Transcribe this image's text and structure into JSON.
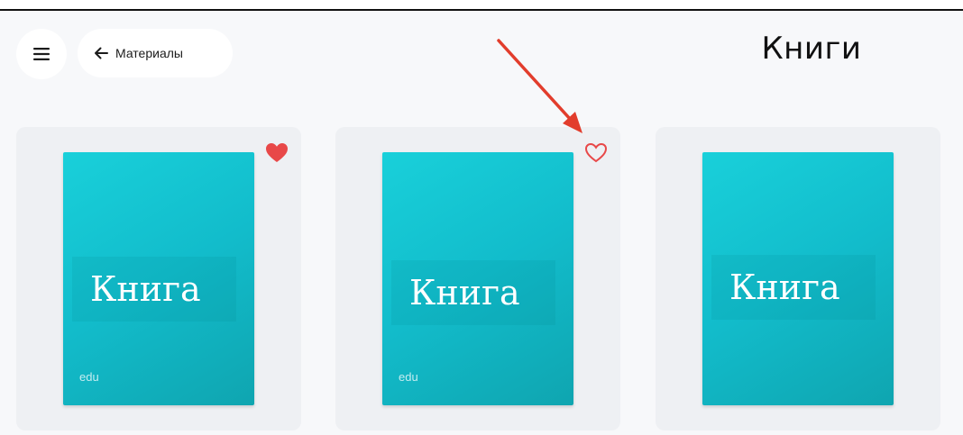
{
  "header": {
    "menu_icon": "hamburger-icon",
    "back_icon": "arrow-left-icon",
    "back_label": "Материалы",
    "title": "Книги"
  },
  "books": [
    {
      "cover_title": "Книга",
      "cover_footer": "edu",
      "favorited": true
    },
    {
      "cover_title": "Книга",
      "cover_footer": "edu",
      "favorited": false
    },
    {
      "cover_title": "Книга",
      "cover_footer": "",
      "favorited": false
    }
  ],
  "colors": {
    "favorite": "#e84848",
    "annotation_arrow": "#e23d2c",
    "cover": "#14c2cf"
  }
}
